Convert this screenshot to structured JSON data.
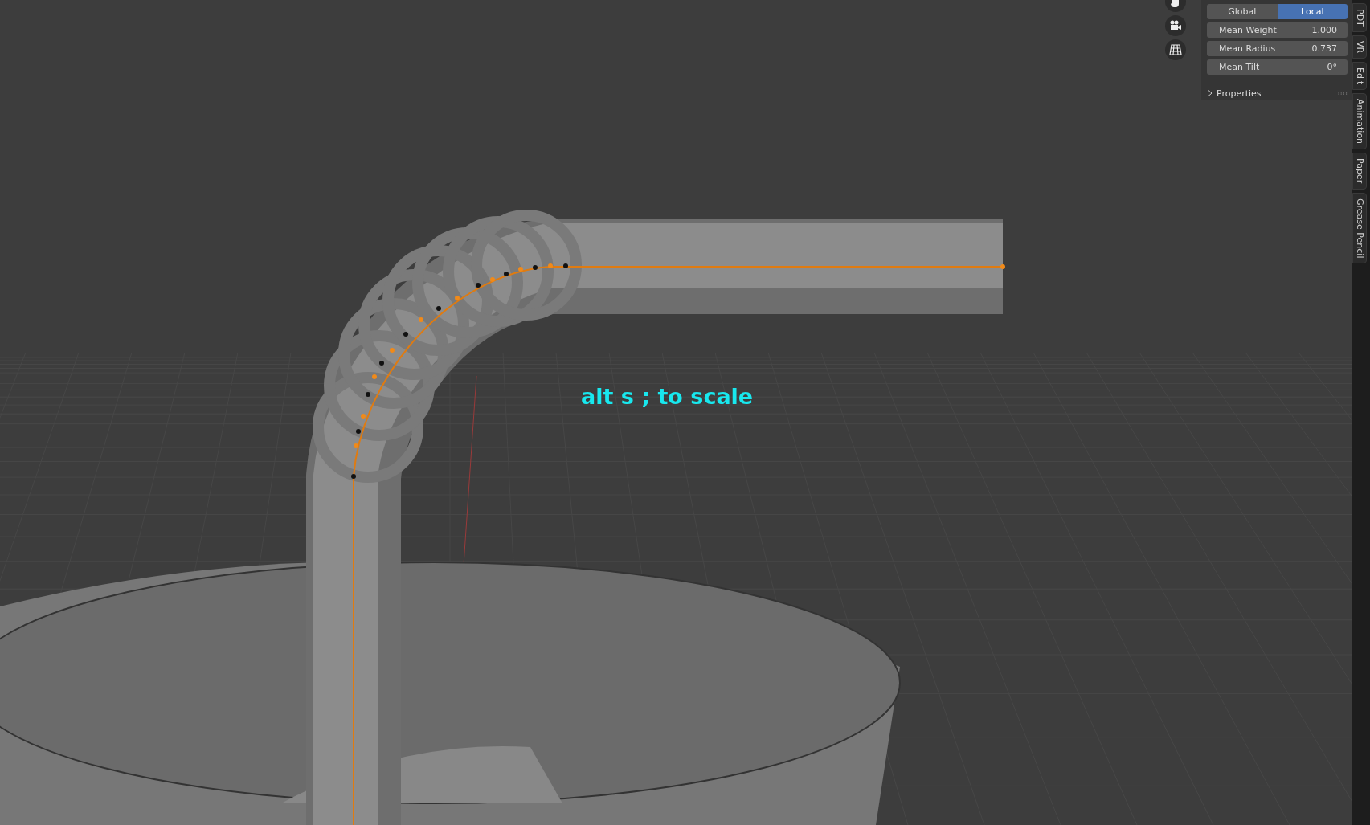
{
  "viewport": {
    "annotation": "alt s ; to scale"
  },
  "transform_panel": {
    "space_toggle": [
      {
        "label": "Global",
        "selected": false
      },
      {
        "label": "Local",
        "selected": true
      }
    ],
    "fields": [
      {
        "label": "Mean Weight",
        "value": "1.000"
      },
      {
        "label": "Mean Radius",
        "value": "0.737"
      },
      {
        "label": "Mean Tilt",
        "value": "0°"
      }
    ],
    "properties_section": {
      "label": "Properties",
      "expanded": false
    }
  },
  "sidebar_tabs": [
    {
      "label": "PDT"
    },
    {
      "label": "VR"
    },
    {
      "label": "Edit"
    },
    {
      "label": "Animation"
    },
    {
      "label": "Paper"
    },
    {
      "label": "Grease Pencil"
    }
  ]
}
